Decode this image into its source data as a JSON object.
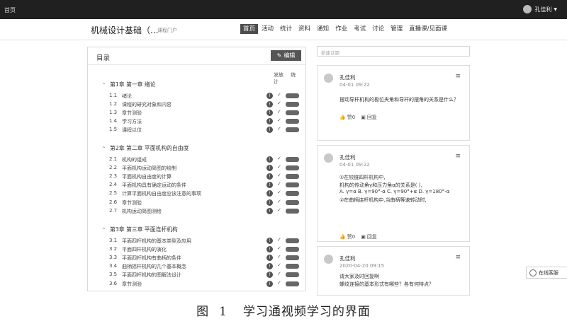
{
  "topbar": {
    "home": "首页",
    "user_name": "孔佳利"
  },
  "course": {
    "title": "机械设计基础（...",
    "portal": "课程门户"
  },
  "nav": [
    "首页",
    "活动",
    "统计",
    "资料",
    "通知",
    "作业",
    "考试",
    "讨论",
    "管理",
    "直播课/见面课"
  ],
  "catalog": {
    "title": "目录",
    "edit": "编辑",
    "col_publish": "发放",
    "col_stats": "统计",
    "info_glyph": "!",
    "check_glyph": "✓",
    "chapters": [
      {
        "title": "第1章 第一章 绪论",
        "lessons": [
          {
            "num": "1.1",
            "title": "绪论"
          },
          {
            "num": "1.2",
            "title": "课程的研究对象和内容"
          },
          {
            "num": "1.3",
            "title": "章节测验"
          },
          {
            "num": "1.4",
            "title": "学习方法"
          },
          {
            "num": "1.5",
            "title": "课程以位"
          }
        ]
      },
      {
        "title": "第2章 第二章 平面机构的自由度",
        "lessons": [
          {
            "num": "2.1",
            "title": "机构的组成"
          },
          {
            "num": "2.2",
            "title": "平面机构运动简图的绘制"
          },
          {
            "num": "2.3",
            "title": "平面机构自由度的计算"
          },
          {
            "num": "2.4",
            "title": "平面机构具有确定运动的条件"
          },
          {
            "num": "2.5",
            "title": "计算平面机构自由度应该注意的事项"
          },
          {
            "num": "2.6",
            "title": "章节测验"
          },
          {
            "num": "2.7",
            "title": "机构运动简图测绘"
          }
        ]
      },
      {
        "title": "第3章 第三章 平面连杆机构",
        "lessons": [
          {
            "num": "3.1",
            "title": "平面四杆机构的基本类型及应用"
          },
          {
            "num": "3.2",
            "title": "平面四杆机构的演化"
          },
          {
            "num": "3.3",
            "title": "平面四杆机构有曲柄的条件"
          },
          {
            "num": "3.4",
            "title": "曲柄摇杆机构的几个基本概念"
          },
          {
            "num": "3.5",
            "title": "平面四杆机构的图解法设计"
          },
          {
            "num": "3.6",
            "title": "章节测验"
          }
        ]
      }
    ]
  },
  "discussion": {
    "new_topic_placeholder": "新建话题",
    "menu_glyph": "≡",
    "like_label": "赞0",
    "reply_label": "回复",
    "posts": [
      {
        "author": "孔佳利",
        "date": "04-01 09:22",
        "lines": [
          "摆动导杆机构的极位夹角和导杆的摆角的关系是什么？"
        ]
      },
      {
        "author": "孔佳利",
        "date": "04-01 09:22",
        "lines": [
          "①在铰链四杆机构中,",
          "机构的传动角γ和压力角α的关系是(   ),",
          "A. γ=α B. γ=90°-α C. γ=90°+α D. γ=180°-α",
          "②在曲柄连杆机构中,当曲柄等速转动时,"
        ]
      },
      {
        "author": "孔佳利",
        "date": "2020-04-20 09:15",
        "lines": [
          "请大家及时回复啊",
          "螺纹连接的基本形式有哪些？各有何特点？"
        ]
      }
    ]
  },
  "service": {
    "label": "在线客服"
  },
  "caption": {
    "fig": "图",
    "num": "1",
    "text": "学习通视频学习的界面"
  }
}
